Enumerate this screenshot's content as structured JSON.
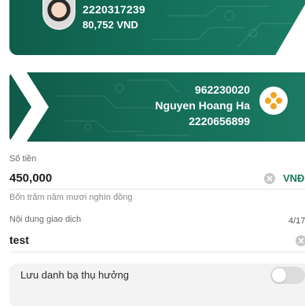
{
  "source_account": {
    "account_number": "2220317239",
    "balance": "80,752 VND"
  },
  "destination": {
    "account_number": "962230020",
    "name": "Nguyen Hoang Ha",
    "secondary_number": "2220656899"
  },
  "amount": {
    "label": "Số tiền",
    "value": "450,000",
    "currency": "VNĐ",
    "in_words": "Bốn trăm năm mươi nghìn đồng"
  },
  "description": {
    "label": "Nội dung giao dịch",
    "value": "test",
    "counter": "4/17"
  },
  "save_beneficiary": {
    "label": "Lưu danh bạ thụ hưởng",
    "enabled": false
  },
  "colors": {
    "card_green": "#14705a",
    "accent": "#1a7a5e"
  }
}
